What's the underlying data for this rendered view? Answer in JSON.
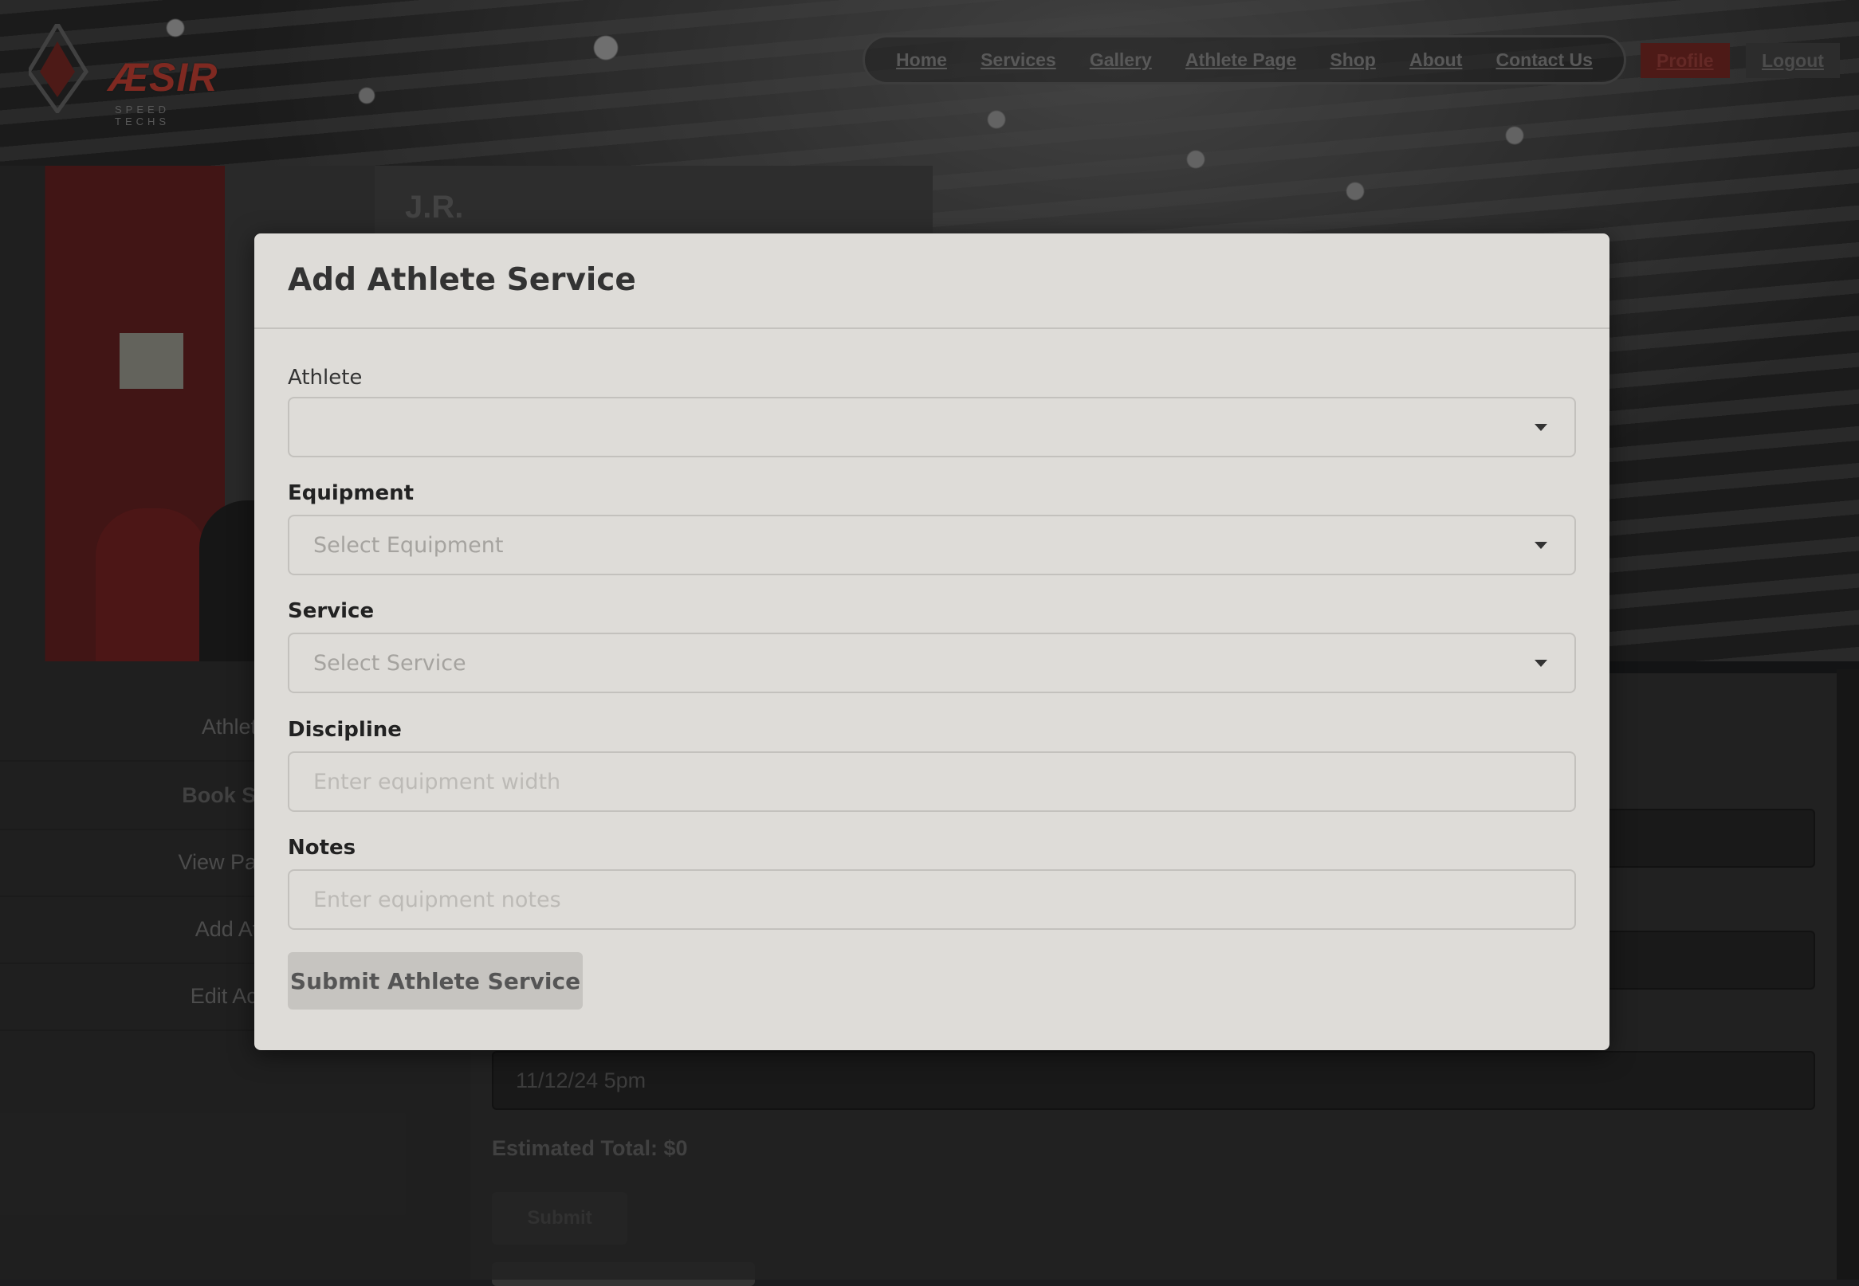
{
  "brand": {
    "logo_word": "ÆSIR",
    "logo_sub": "SPEED TECHS"
  },
  "nav": {
    "links": [
      "Home",
      "Services",
      "Gallery",
      "Athlete Page",
      "Shop",
      "About",
      "Contact Us"
    ],
    "profile": "Profile",
    "logout": "Logout"
  },
  "profile_card": {
    "name": "J.R."
  },
  "sidebar": {
    "items": [
      {
        "label": "Athlete"
      },
      {
        "label": "Book Serv"
      },
      {
        "label": "View Past T"
      },
      {
        "label": "Add Athl"
      },
      {
        "label": "Edit Acco"
      }
    ]
  },
  "booking_form": {
    "date_value": "11/12/24 5pm",
    "estimated_total": "Estimated Total: $0",
    "submit_label": "Submit"
  },
  "modal": {
    "title": "Add Athlete Service",
    "athlete": {
      "label": "Athlete",
      "value": ""
    },
    "equipment": {
      "label": "Equipment",
      "placeholder": "Select Equipment"
    },
    "service": {
      "label": "Service",
      "placeholder": "Select Service"
    },
    "discipline": {
      "label": "Discipline",
      "placeholder": "Enter equipment width"
    },
    "notes": {
      "label": "Notes",
      "placeholder": "Enter equipment notes"
    },
    "submit_label": "Submit Athlete Service"
  },
  "colors": {
    "modal_bg": "#dedcd8",
    "profile_accent": "#6b2420",
    "backdrop": "#1b1c1e"
  }
}
